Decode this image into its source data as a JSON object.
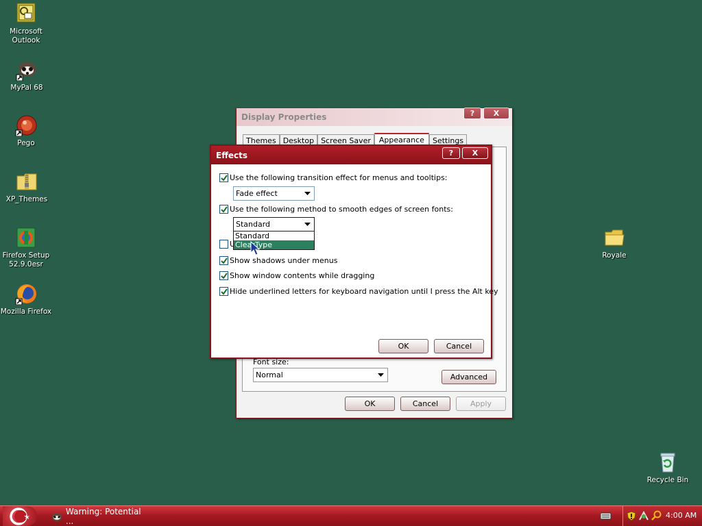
{
  "desktop": {
    "icons": [
      {
        "name": "outlook",
        "label": "Microsoft\nOutlook"
      },
      {
        "name": "mypal",
        "label": "MyPal 68"
      },
      {
        "name": "pego",
        "label": "Pego"
      },
      {
        "name": "xp-themes",
        "label": "XP_Themes"
      },
      {
        "name": "firefox-setup",
        "label": "Firefox Setup\n52.9.0esr"
      },
      {
        "name": "mozilla-firefox",
        "label": "Mozilla Firefox"
      },
      {
        "name": "royale",
        "label": "Royale"
      },
      {
        "name": "recycle-bin",
        "label": "Recycle Bin"
      }
    ]
  },
  "display_properties": {
    "title": "Display Properties",
    "title_buttons": [
      "?",
      "X"
    ],
    "tabs": [
      "Themes",
      "Desktop",
      "Screen Saver",
      "Appearance",
      "Settings"
    ],
    "active_tab": "Appearance",
    "font_size_label": "Font size:",
    "font_size_value": "Normal",
    "advanced_label": "Advanced",
    "ok_label": "OK",
    "cancel_label": "Cancel",
    "apply_label": "Apply"
  },
  "effects": {
    "title": "Effects",
    "title_buttons": [
      "?",
      "X"
    ],
    "option1_label": "Use the following transition effect for menus and tooltips:",
    "option1_checked": true,
    "transition_value": "Fade effect",
    "option2_label": "Use the following method to smooth edges of screen fonts:",
    "option2_checked": true,
    "smoothing_value": "Standard",
    "smoothing_options": [
      "Standard",
      "ClearType"
    ],
    "smoothing_highlighted": "ClearType",
    "option3_label": "U",
    "option3_checked": false,
    "option4_label": "Show shadows under menus",
    "option4_checked": true,
    "option5_label": "Show window contents while dragging",
    "option5_checked": true,
    "option6_label": "Hide underlined letters for keyboard navigation until I press the Alt key",
    "option6_checked": true,
    "ok_label": "OK",
    "cancel_label": "Cancel"
  },
  "taskbar": {
    "task_label": "Warning: Potential ...",
    "clock": "4:00 AM"
  },
  "colors": {
    "desktop": "#285e4a",
    "accent": "#a41820",
    "highlight": "#2b8060"
  }
}
